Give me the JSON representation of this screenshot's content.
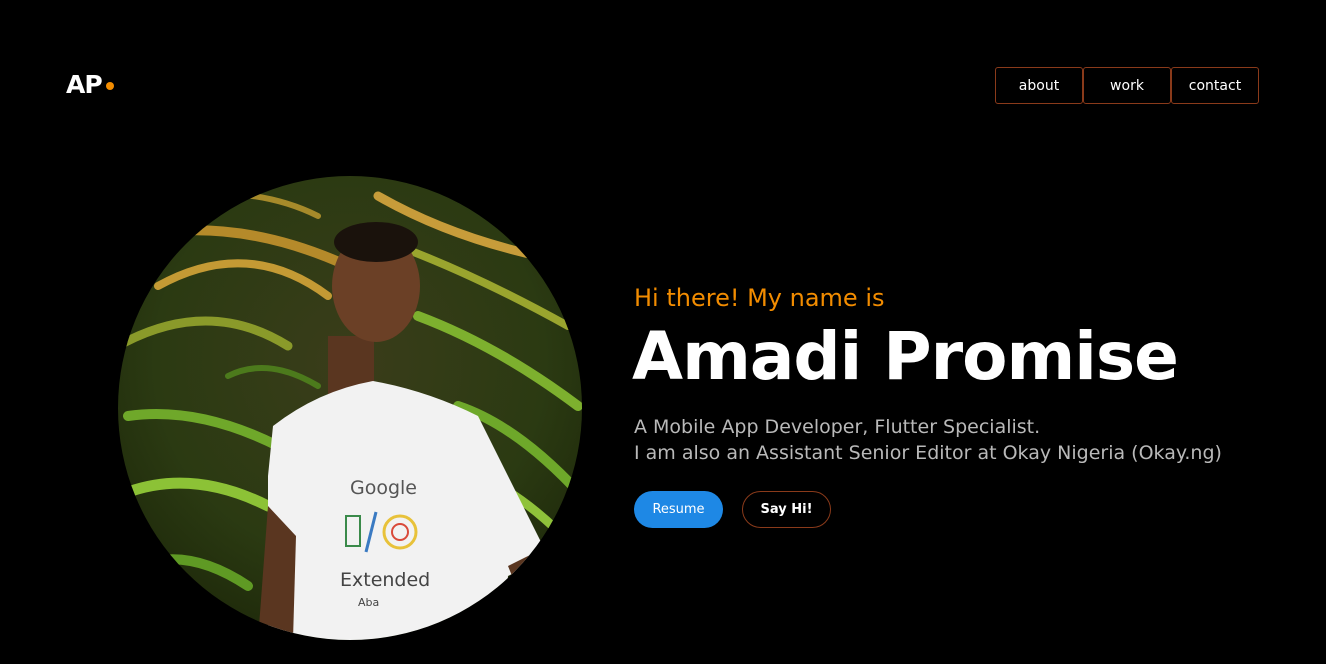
{
  "logo": {
    "text": "AP",
    "accent_color": "#f28c00"
  },
  "nav": {
    "items": [
      {
        "label": "about"
      },
      {
        "label": "work"
      },
      {
        "label": "contact"
      }
    ],
    "border_color": "#8a3a1a"
  },
  "hero": {
    "greeting": "Hi there! My name is",
    "name": "Amadi Promise",
    "description_line1": "A Mobile App Developer, Flutter Specialist.",
    "description_line2": "I am also an Assistant Senior Editor at Okay Nigeria (Okay.ng)",
    "resume_label": "Resume",
    "say_hi_label": "Say Hi!",
    "resume_color": "#1e88e5"
  },
  "portrait": {
    "shirt_text_top": "Google",
    "shirt_text_bottom": "Extended",
    "shirt_text_small": "Aba"
  }
}
